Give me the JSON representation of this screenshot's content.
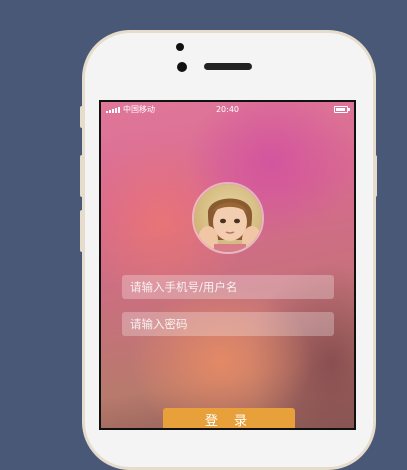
{
  "status_bar": {
    "carrier": "中国移动",
    "time": "20:40"
  },
  "login": {
    "username_placeholder": "请输入手机号/用户名",
    "password_placeholder": "请输入密码",
    "login_button": "登 录"
  }
}
